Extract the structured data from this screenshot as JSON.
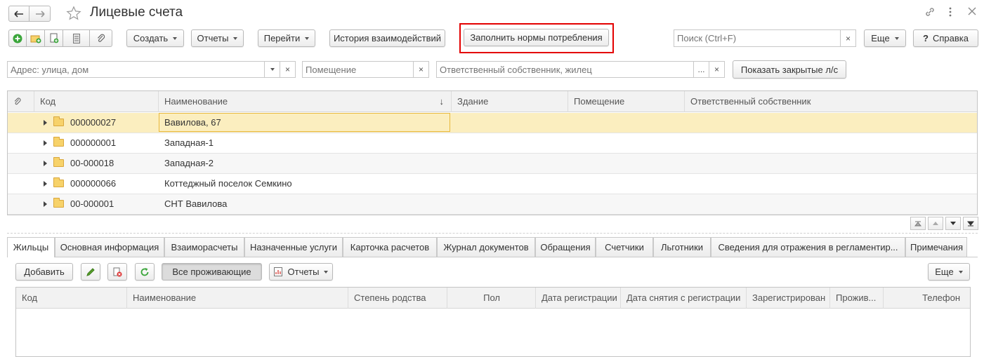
{
  "window": {
    "title": "Лицевые счета",
    "back_icon": "arrow-left-icon",
    "forward_icon": "arrow-right-icon",
    "favorite_icon": "star-icon",
    "link_icon": "link-icon",
    "menu_icon": "more-vertical-icon",
    "close_icon": "close-icon"
  },
  "toolbar": {
    "create_label": "Создать",
    "reports_label": "Отчеты",
    "go_label": "Перейти",
    "history_label": "История взаимодействий",
    "fill_norms_label": "Заполнить нормы потребления",
    "search_placeholder": "Поиск (Ctrl+F)",
    "search_clear": "×",
    "more_label": "Еще",
    "help_label": "Справка",
    "help_mark": "?"
  },
  "filters": {
    "address_placeholder": "Адрес: улица, дом",
    "room_placeholder": "Помещение",
    "owner_placeholder": "Ответственный собственник, жилец",
    "ellipsis": "...",
    "clear": "×",
    "show_closed_label": "Показать закрытые л/с"
  },
  "accounts_table": {
    "columns": [
      "Код",
      "Наименование",
      "Здание",
      "Помещение",
      "Ответственный собственник"
    ],
    "sort_arrow": "↓",
    "rows": [
      {
        "code": "000000027",
        "name": "Вавилова, 67",
        "selected": true
      },
      {
        "code": "000000001",
        "name": "Западная-1",
        "selected": false
      },
      {
        "code": "00-000018",
        "name": "Западная-2",
        "selected": false
      },
      {
        "code": "000000066",
        "name": "Коттеджный поселок Семкино",
        "selected": false
      },
      {
        "code": "00-000001",
        "name": "СНТ Вавилова",
        "selected": false
      }
    ]
  },
  "tabs": [
    "Жильцы",
    "Основная информация",
    "Взаиморасчеты",
    "Назначенные услуги",
    "Карточка расчетов",
    "Журнал документов",
    "Обращения",
    "Счетчики",
    "Льготники",
    "Сведения для отражения в регламентир...",
    "Примечания"
  ],
  "residents": {
    "add_label": "Добавить",
    "all_residents_label": "Все проживающие",
    "reports_label": "Отчеты",
    "more_label": "Еще",
    "columns": [
      "Код",
      "Наименование",
      "Степень родства",
      "Пол",
      "Дата регистрации",
      "Дата снятия с регистрации",
      "Зарегистрирован",
      "Прожив...",
      "Телефон"
    ]
  },
  "colors": {
    "selected_row": "#fbeebf",
    "highlight_frame": "#e30000",
    "selected_cell_border": "#e8b83c"
  }
}
